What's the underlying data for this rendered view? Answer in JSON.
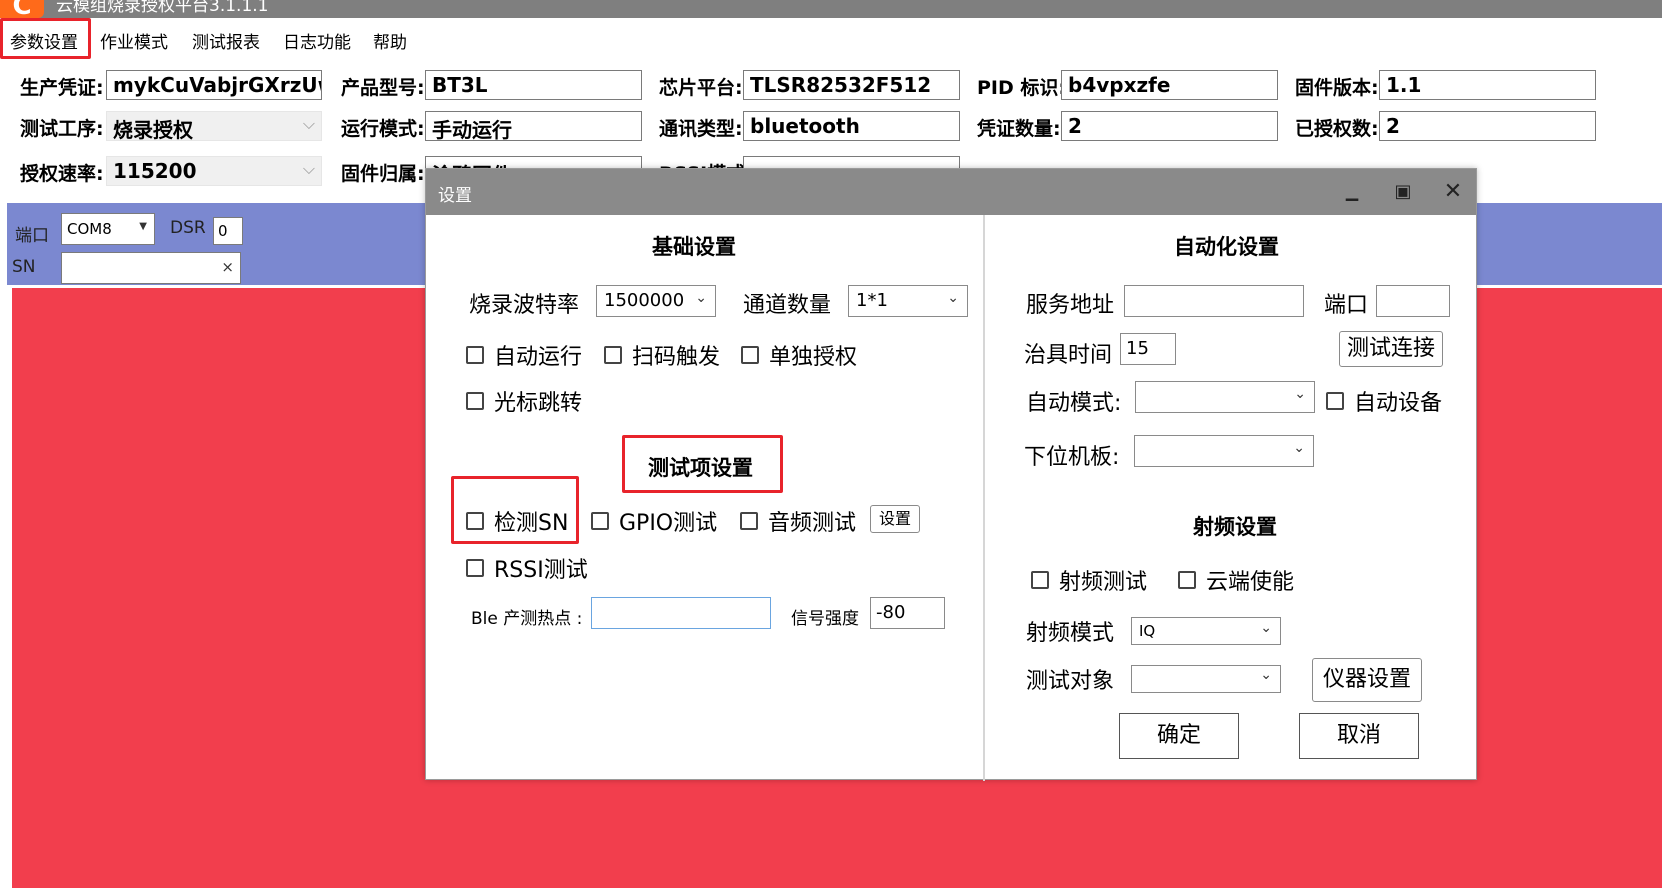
{
  "app": {
    "title": "云模组烧录授权平台3.1.1.1",
    "logo": "C"
  },
  "menu": [
    "参数设置",
    "作业模式",
    "测试报表",
    "日志功能",
    "帮助"
  ],
  "fields": {
    "credential": {
      "label": "生产凭证:",
      "value": "mykCuVabjrGXrzUw"
    },
    "product_model": {
      "label": "产品型号:",
      "value": "BT3L"
    },
    "chip_platform": {
      "label": "芯片平台:",
      "value": "TLSR82532F512"
    },
    "pid": {
      "label": "PID 标识:",
      "value": "b4vpxzfe"
    },
    "firmware_version": {
      "label": "固件版本:",
      "value": "1.1"
    },
    "process": {
      "label": "测试工序:",
      "value": "烧录授权"
    },
    "run_mode": {
      "label": "运行模式:",
      "value": "手动运行"
    },
    "comm_type": {
      "label": "通讯类型:",
      "value": "bluetooth"
    },
    "cred_count": {
      "label": "凭证数量:",
      "value": "2"
    },
    "authorized": {
      "label": "已授权数:",
      "value": "2"
    },
    "auth_rate": {
      "label": "授权速率:",
      "value": "115200"
    },
    "firmware_owner": {
      "label": "固件归属:",
      "value": "涂鸦固件"
    },
    "rssi_mode": {
      "label": "RSSI模式",
      "value": ""
    }
  },
  "port_bar": {
    "port_label": "端口",
    "port_value": "COM8",
    "dsr_label": "DSR",
    "dsr_value": "0",
    "sn_label": "SN",
    "sn_value": "",
    "clear_glyph": "×"
  },
  "dialog": {
    "title": "设置",
    "controls": {
      "minimize": "▁",
      "maximize": "▣",
      "close": "✕"
    },
    "basic": {
      "heading": "基础设置",
      "baud_label": "烧录波特率",
      "baud_value": "1500000",
      "channel_label": "通道数量",
      "channel_value": "1*1",
      "checkboxes": [
        "自动运行",
        "扫码触发",
        "单独授权",
        "光标跳转"
      ]
    },
    "test_items": {
      "heading": "测试项设置",
      "checkboxes": [
        "检测SN",
        "GPIO测试",
        "音频测试",
        "RSSI测试"
      ],
      "settings_button": "设置",
      "ble_label": "Ble 产测热点 :",
      "ble_value": "",
      "signal_label": "信号强度",
      "signal_value": "-80"
    },
    "automation": {
      "heading": "自动化设置",
      "server_label": "服务地址",
      "server_value": "",
      "port_label": "端口",
      "port_value": "",
      "fixture_label": "治具时间",
      "fixture_value": "15",
      "test_conn_button": "测试连接",
      "auto_mode_label": "自动模式:",
      "auto_mode_value": "",
      "auto_device_cb": "自动设备",
      "lower_board_label": "下位机板:",
      "lower_board_value": ""
    },
    "rf": {
      "heading": "射频设置",
      "checkboxes": [
        "射频测试",
        "云端使能"
      ],
      "rf_mode_label": "射频模式",
      "rf_mode_value": "IQ",
      "test_target_label": "测试对象",
      "test_target_value": "",
      "instrument_button": "仪器设置"
    },
    "ok_button": "确定",
    "cancel_button": "取消"
  },
  "colors": {
    "accent_red": "#e8232b",
    "blue_bar": "#7b88d0",
    "red_area": "#f23e4d",
    "logo_orange": "#ff6a1a"
  }
}
